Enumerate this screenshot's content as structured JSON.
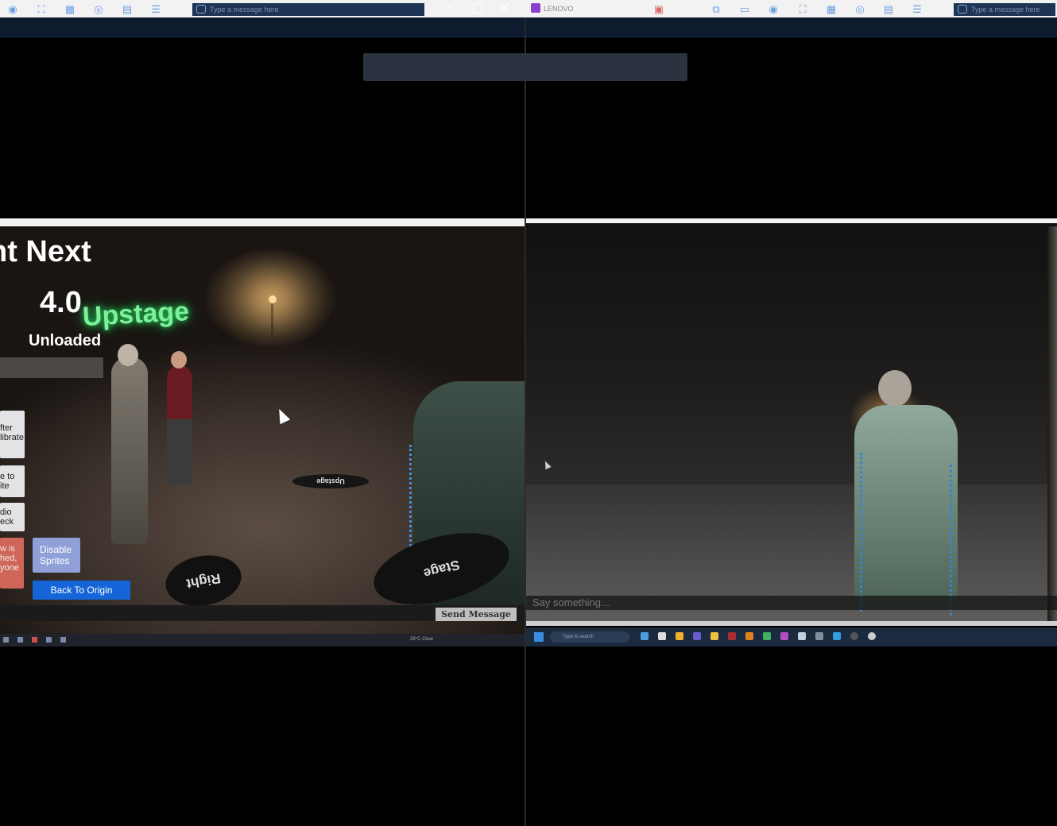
{
  "left_window": {
    "message_placeholder": "Type a message here",
    "scene": {
      "title_partial": "nt  Next",
      "version": "4.0",
      "upstage_label": "Upstage",
      "status": "Unloaded",
      "side_buttons": [
        "fter\nlibrate",
        "e to\nite",
        "dio\neck",
        "w is\nhed,\nyone"
      ],
      "disable_sprites": "Disable\nSprites",
      "back_to_origin": "Back To Origin",
      "floor_marks": [
        "Right",
        "Upstage",
        "Stage"
      ],
      "send_message": "Send Message"
    },
    "tray_text": "29°C  Clear"
  },
  "right_window": {
    "app_title": "LENOVO",
    "message_placeholder": "Type a message here",
    "scene": {
      "say_placeholder": "Say something..."
    },
    "taskbar_search": "Type to search"
  },
  "colors": {
    "toolbar_bg": "#0e1a2e",
    "upstage_glow": "#7df09a",
    "origin_button": "#1565d8",
    "disable_button": "#8fa0d8",
    "red_button": "#d0665a"
  }
}
